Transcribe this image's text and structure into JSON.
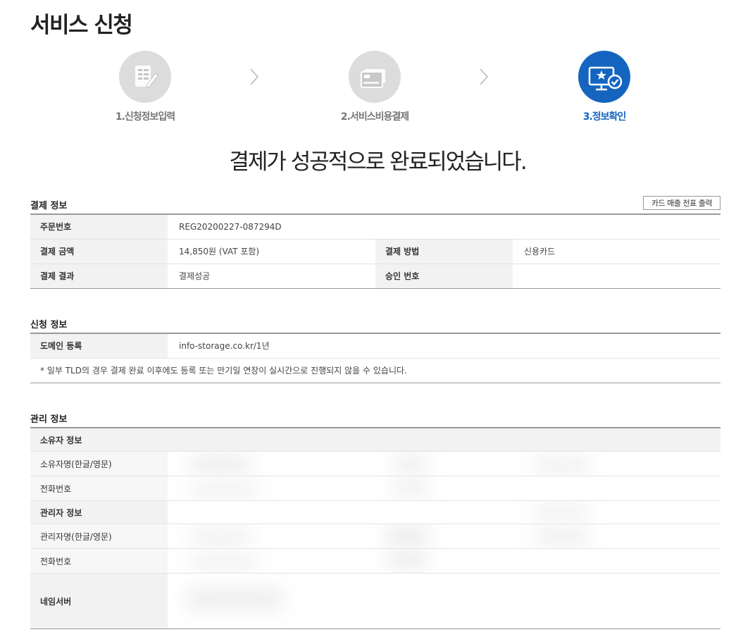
{
  "page": {
    "title": "서비스 신청"
  },
  "steps": [
    {
      "label": "1.신청정보입력",
      "active": false,
      "icon": "form-edit-icon"
    },
    {
      "label": "2.서비스비용결제",
      "active": false,
      "icon": "credit-card-icon"
    },
    {
      "label": "3.정보확인",
      "active": true,
      "icon": "monitor-check-icon"
    }
  ],
  "headline": "결제가 성공적으로 완료되었습니다.",
  "payment": {
    "title": "결제 정보",
    "receipt_button": "카드 매출 전표 출력",
    "order_no_label": "주문번호",
    "order_no": "REG20200227-087294D",
    "amount_label": "결제 금액",
    "amount": "14,850원 (VAT 포함)",
    "method_label": "결제 방법",
    "method": "신용카드",
    "result_label": "결제 결과",
    "result": "결제성공",
    "approval_label": "승인 번호",
    "approval": ""
  },
  "application": {
    "title": "신청 정보",
    "domain_label": "도메인 등록",
    "domain": "info-storage.co.kr/1년",
    "note": "* 일부 TLD의 경우 결제 완료 이후에도 등록 또는 만기일 연장이 실시간으로 진행되지 않을 수 있습니다."
  },
  "management": {
    "title": "관리 정보",
    "owner_group": "소유자 정보",
    "owner_name_label": "소유자명(한글/영문)",
    "owner_phone_label": "전화번호",
    "admin_group": "관리자 정보",
    "admin_name_label": "관리자명(한글/영문)",
    "admin_phone_label": "전화번호",
    "nameserver_label": "네임서버"
  },
  "colors": {
    "accent": "#1565c0",
    "inactive_step": "#dcdcdc"
  }
}
